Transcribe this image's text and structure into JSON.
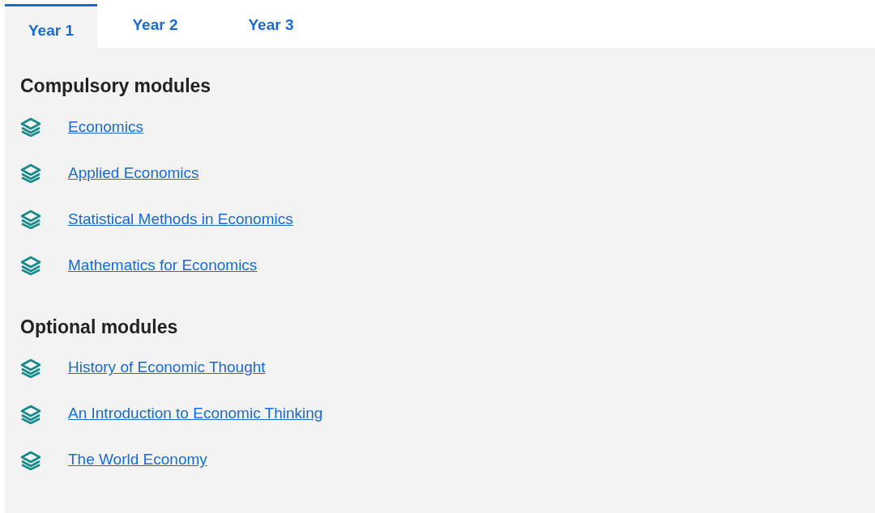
{
  "tabs": [
    {
      "label": "Year 1",
      "selected": true
    },
    {
      "label": "Year 2",
      "selected": false
    },
    {
      "label": "Year 3",
      "selected": false
    }
  ],
  "sections": [
    {
      "title": "Compulsory modules",
      "modules": [
        "Economics",
        "Applied Economics",
        "Statistical Methods in Economics",
        "Mathematics for Economics"
      ]
    },
    {
      "title": "Optional modules",
      "modules": [
        "History of Economic Thought",
        "An Introduction to Economic Thinking",
        "The World Economy"
      ]
    }
  ]
}
